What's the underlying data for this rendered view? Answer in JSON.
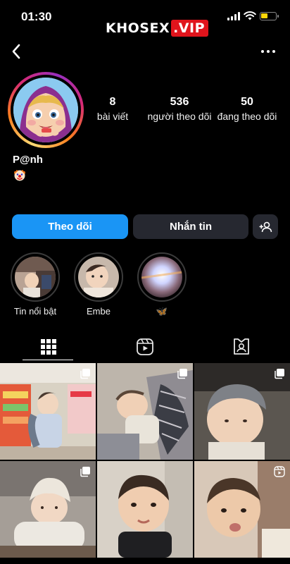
{
  "status_bar": {
    "time": "01:30"
  },
  "watermark": {
    "part1": "KHOSEX",
    "part2": ".VIP"
  },
  "profile": {
    "username": "P@nh",
    "bio_emoji": "clown-face-icon",
    "stats": [
      {
        "value": "8",
        "label": "bài viết"
      },
      {
        "value": "536",
        "label": "người theo dõi"
      },
      {
        "value": "50",
        "label": "đang theo dõi"
      }
    ]
  },
  "actions": {
    "follow_label": "Theo dõi",
    "message_label": "Nhắn tin"
  },
  "highlights": [
    {
      "label": "Tin nổi bật"
    },
    {
      "label": "Embe"
    },
    {
      "label": "🦋"
    }
  ],
  "tabs": [
    "grid-icon",
    "reels-icon",
    "tagged-icon"
  ],
  "colors": {
    "accent": "#1a95f5",
    "button_dark": "#262830",
    "background": "#000000"
  },
  "posts": [
    {
      "badge": "carousel-icon"
    },
    {
      "badge": "carousel-icon"
    },
    {
      "badge": "carousel-icon"
    },
    {
      "badge": "carousel-icon"
    },
    {
      "badge": "none"
    },
    {
      "badge": "reels-icon"
    }
  ]
}
